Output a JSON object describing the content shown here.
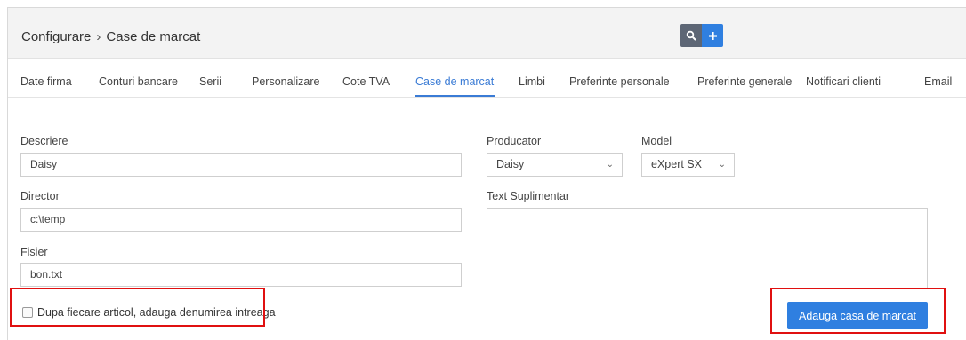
{
  "header": {
    "breadcrumb_root": "Configurare",
    "breadcrumb_sep": "›",
    "breadcrumb_current": "Case de marcat"
  },
  "tabs": [
    {
      "label": "Date firma"
    },
    {
      "label": "Conturi bancare"
    },
    {
      "label": "Serii"
    },
    {
      "label": "Personalizare"
    },
    {
      "label": "Cote TVA"
    },
    {
      "label": "Case de marcat"
    },
    {
      "label": "Limbi"
    },
    {
      "label": "Preferinte personale"
    },
    {
      "label": "Preferinte generale"
    },
    {
      "label": "Notificari clienti"
    },
    {
      "label": "Email"
    }
  ],
  "active_tab": "Case de marcat",
  "form": {
    "descriere_label": "Descriere",
    "descriere_value": "Daisy",
    "director_label": "Director",
    "director_value": "c:\\temp",
    "fisier_label": "Fisier",
    "fisier_value": "bon.txt",
    "producator_label": "Producator",
    "producator_value": "Daisy",
    "model_label": "Model",
    "model_value": "eXpert SX",
    "text_suplimentar_label": "Text Suplimentar",
    "text_suplimentar_value": "",
    "checkbox_label": "Dupa fiecare articol, adauga denumirea intreaga",
    "checkbox_checked": false,
    "submit_label": "Adauga casa de marcat"
  },
  "colors": {
    "accent": "#2f7fe0",
    "active_tab": "#3a7bd5",
    "highlight": "#e01010"
  },
  "icons": {
    "search": "search-icon",
    "add": "plus-icon",
    "dropdown": "chevron-down-icon"
  }
}
